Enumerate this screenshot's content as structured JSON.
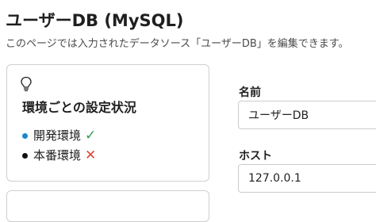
{
  "page": {
    "title": "ユーザーDB (MySQL)",
    "subtitle": "このページでは入力されたデータソース「ユーザーDB」を編集できます。"
  },
  "card": {
    "icon": "lightbulb-icon",
    "title": "環境ごとの設定状況",
    "environments": [
      {
        "label": "開発環境",
        "dot_color": "#1a86d0",
        "status_icon": "check-icon",
        "status_glyph": "✓",
        "status_color": "#2e9e4d"
      },
      {
        "label": "本番環境",
        "dot_color": "#111111",
        "status_icon": "cross-icon",
        "status_glyph": "✕",
        "status_color": "#e0453a"
      }
    ]
  },
  "form": {
    "name_label": "名前",
    "name_value": "ユーザーDB",
    "host_label": "ホスト",
    "host_value": "127.0.0.1"
  }
}
